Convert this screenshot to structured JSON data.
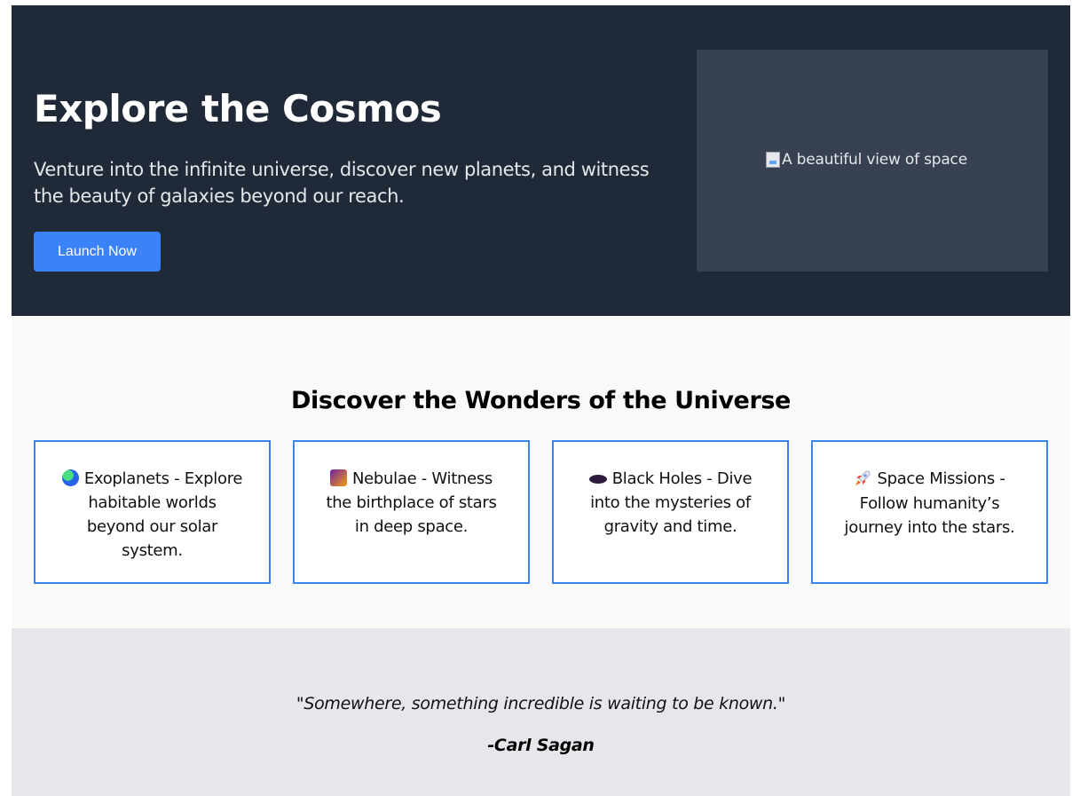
{
  "hero": {
    "title": "Explore the Cosmos",
    "subtitle": "Venture into the infinite universe, discover new planets, and witness the beauty of galaxies beyond our reach.",
    "button_label": "Launch Now",
    "image_alt": "A beautiful view of space",
    "accent_color": "#3b82f6",
    "background_color": "#1f2937"
  },
  "features": {
    "title": "Discover the Wonders of the Universe",
    "cards": [
      {
        "icon": "globe-icon",
        "text": "Exoplanets - Explore habitable worlds beyond our solar system."
      },
      {
        "icon": "nebula-icon",
        "text": "Nebulae - Witness the birthplace of stars in deep space."
      },
      {
        "icon": "black-hole-icon",
        "text": "Black Holes - Dive into the mysteries of gravity and time."
      },
      {
        "icon": "rocket-icon",
        "text": "Space Missions - Follow humanity’s journey into the stars."
      }
    ]
  },
  "quote": {
    "text": "\"Somewhere, something incredible is waiting to be known.\"",
    "author": "-Carl Sagan"
  }
}
